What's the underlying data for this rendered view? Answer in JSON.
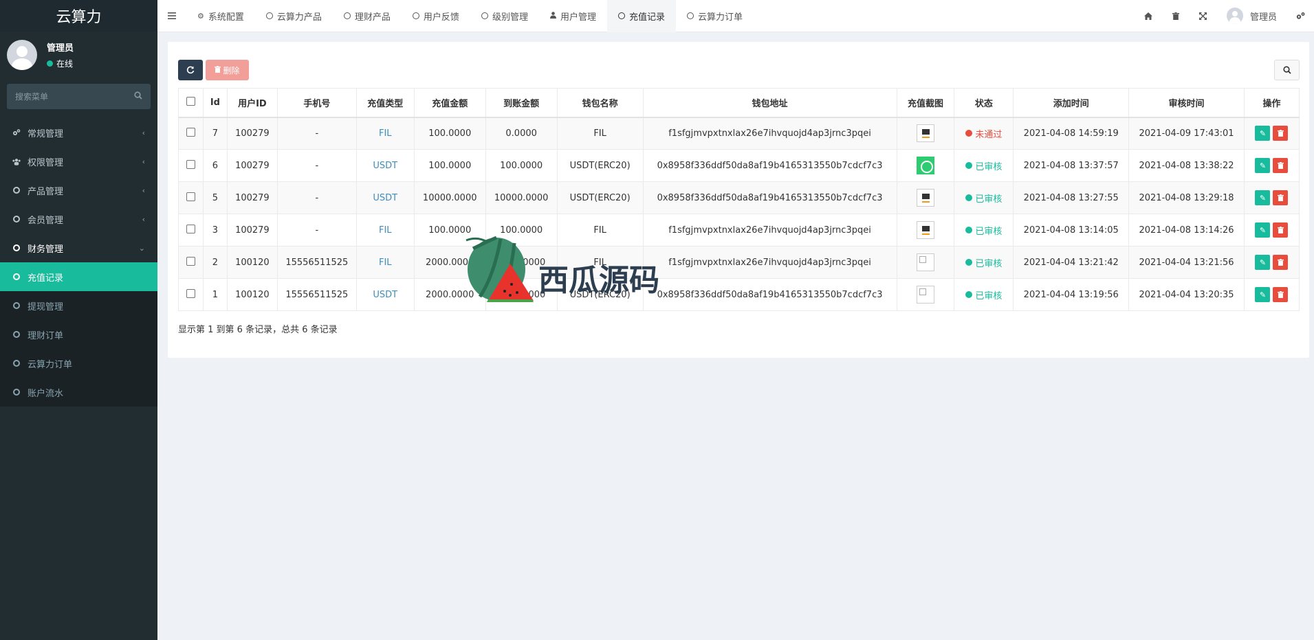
{
  "brand": "云算力",
  "user": {
    "name": "管理员",
    "status": "在线"
  },
  "search": {
    "placeholder": "搜索菜单"
  },
  "menu": [
    {
      "label": "常规管理",
      "icon": "cogs-icon"
    },
    {
      "label": "权限管理",
      "icon": "group-icon"
    },
    {
      "label": "产品管理",
      "icon": "circle-icon"
    },
    {
      "label": "会员管理",
      "icon": "circle-icon"
    },
    {
      "label": "财务管理",
      "icon": "circle-icon"
    }
  ],
  "submenu": [
    {
      "label": "充值记录"
    },
    {
      "label": "提现管理"
    },
    {
      "label": "理财订单"
    },
    {
      "label": "云算力订单"
    },
    {
      "label": "账户流水"
    }
  ],
  "tabs": [
    {
      "label": "系统配置",
      "icon": "gear-icon"
    },
    {
      "label": "云算力产品",
      "icon": "circle-icon"
    },
    {
      "label": "理财产品",
      "icon": "circle-icon"
    },
    {
      "label": "用户反馈",
      "icon": "circle-icon"
    },
    {
      "label": "级别管理",
      "icon": "circle-icon"
    },
    {
      "label": "用户管理",
      "icon": "user-icon"
    },
    {
      "label": "充值记录",
      "icon": "circle-icon"
    },
    {
      "label": "云算力订单",
      "icon": "circle-icon"
    }
  ],
  "topbar_user": "管理员",
  "toolbar": {
    "delete_label": "删除"
  },
  "table": {
    "headers": [
      "Id",
      "用户ID",
      "手机号",
      "充值类型",
      "充值金额",
      "到账金额",
      "钱包名称",
      "钱包地址",
      "充值截图",
      "状态",
      "添加时间",
      "审核时间",
      "操作"
    ],
    "rows": [
      {
        "id": "7",
        "uid": "100279",
        "phone": "-",
        "type": "FIL",
        "amount": "100.0000",
        "received": "0.0000",
        "wallet": "FIL",
        "address": "f1sfgjmvpxtnxlax26e7ihvquojd4ap3jrnc3pqei",
        "status": "未通过",
        "added": "2021-04-08 14:59:19",
        "reviewed": "2021-04-09 17:43:01"
      },
      {
        "id": "6",
        "uid": "100279",
        "phone": "-",
        "type": "USDT",
        "amount": "100.0000",
        "received": "100.0000",
        "wallet": "USDT(ERC20)",
        "address": "0x8958f336ddf50da8af19b4165313550b7cdcf7c3",
        "status": "已审核",
        "added": "2021-04-08 13:37:57",
        "reviewed": "2021-04-08 13:38:22"
      },
      {
        "id": "5",
        "uid": "100279",
        "phone": "-",
        "type": "USDT",
        "amount": "10000.0000",
        "received": "10000.0000",
        "wallet": "USDT(ERC20)",
        "address": "0x8958f336ddf50da8af19b4165313550b7cdcf7c3",
        "status": "已审核",
        "added": "2021-04-08 13:27:55",
        "reviewed": "2021-04-08 13:29:18"
      },
      {
        "id": "3",
        "uid": "100279",
        "phone": "-",
        "type": "FIL",
        "amount": "100.0000",
        "received": "100.0000",
        "wallet": "FIL",
        "address": "f1sfgjmvpxtnxlax26e7ihvquojd4ap3jrnc3pqei",
        "status": "已审核",
        "added": "2021-04-08 13:14:05",
        "reviewed": "2021-04-08 13:14:26"
      },
      {
        "id": "2",
        "uid": "100120",
        "phone": "15556511525",
        "type": "FIL",
        "amount": "2000.0000",
        "received": "2000.0000",
        "wallet": "FIL",
        "address": "f1sfgjmvpxtnxlax26e7ihvquojd4ap3jrnc3pqei",
        "status": "已审核",
        "added": "2021-04-04 13:21:42",
        "reviewed": "2021-04-04 13:21:56"
      },
      {
        "id": "1",
        "uid": "100120",
        "phone": "15556511525",
        "type": "USDT",
        "amount": "2000.0000",
        "received": "2000.0000",
        "wallet": "USDT(ERC20)",
        "address": "0x8958f336ddf50da8af19b4165313550b7cdcf7c3",
        "status": "已审核",
        "added": "2021-04-04 13:19:56",
        "reviewed": "2021-04-04 13:20:35"
      }
    ]
  },
  "summary": "显示第 1 到第 6 条记录，总共 6 条记录",
  "watermark": "西瓜源码",
  "colors": {
    "accent": "#18bc9c",
    "sidebar": "#222d32",
    "danger": "#e74c3c",
    "link": "#3c8dbc"
  }
}
